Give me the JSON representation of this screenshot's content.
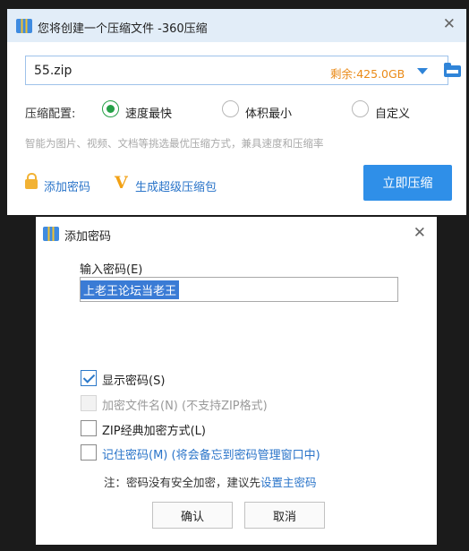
{
  "compress_window": {
    "title": "您将创建一个压缩文件 -360压缩",
    "close": "✕",
    "archive_name": "55.zip",
    "free_space": "剩余:425.0GB",
    "config_label": "压缩配置:",
    "options": [
      {
        "label": "速度最快",
        "selected": true
      },
      {
        "label": "体积最小",
        "selected": false
      },
      {
        "label": "自定义",
        "selected": false
      }
    ],
    "hint": "智能为图片、视频、文档等挑选最优压缩方式，兼具速度和压缩率",
    "add_password_link": "添加密码",
    "super_pack_link": "生成超级压缩包",
    "super_pack_badge": "V",
    "compress_button": "立即压缩"
  },
  "password_dialog": {
    "title": "添加密码",
    "close": "✕",
    "input_label": "输入密码(E)",
    "password_value": "上老王论坛当老王",
    "checkboxes": [
      {
        "label": "显示密码(S)",
        "checked": true,
        "enabled": true
      },
      {
        "label": "加密文件名(N)  (不支持ZIP格式)",
        "checked": false,
        "enabled": false
      },
      {
        "label": "ZIP经典加密方式(L)",
        "checked": false,
        "enabled": true
      },
      {
        "label": "记住密码(M) (将会备忘到密码管理窗口中)",
        "checked": false,
        "enabled": true
      }
    ],
    "note_prefix": "注：密码没有安全加密，建议先",
    "note_link": "设置主密码",
    "ok_button": "确认",
    "cancel_button": "取消"
  },
  "colors": {
    "accent_blue": "#2f8fe8",
    "link_blue": "#2a74c9",
    "free_space_orange": "#ea8a17",
    "radio_green": "#25a047",
    "titlebar_bg": "#e2edf8"
  }
}
